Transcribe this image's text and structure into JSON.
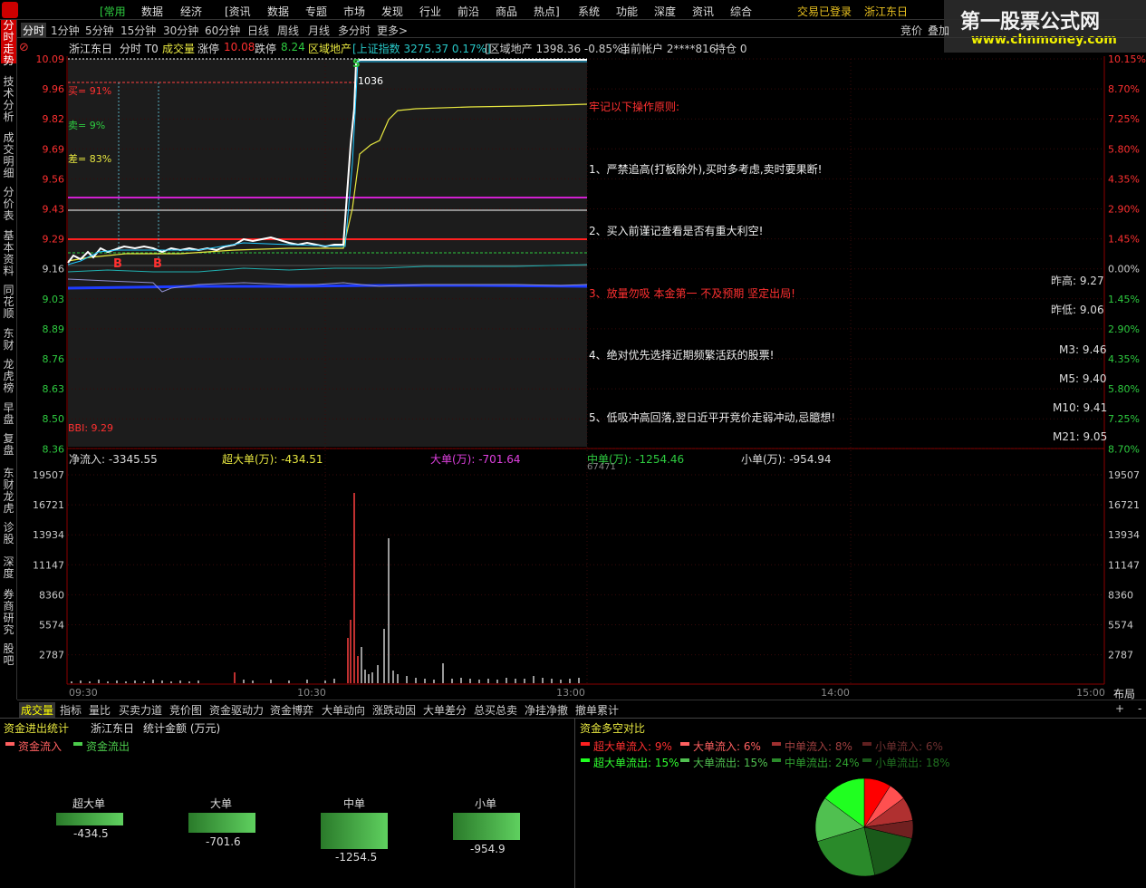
{
  "menu": {
    "items": [
      "[常用",
      "数据",
      "经济",
      "[资讯",
      "数据",
      "专题",
      "市场",
      "发现",
      "行业",
      "前沿",
      "商品",
      "热点]",
      "系统",
      "功能",
      "深度",
      "资讯",
      "综合"
    ],
    "login": "交易已登录",
    "stock": "浙江东日",
    "right_items": [
      "竞价",
      "叠加"
    ]
  },
  "watermark": {
    "title": "第一股票公式网",
    "url": "www.chnmoney.com"
  },
  "sidebar": [
    "分时走势",
    "技术分析",
    "成交明细",
    "分价表",
    "基本资料",
    "同花顺",
    "东财",
    "龙虎榜",
    "早盘",
    "复盘",
    "东财龙虎",
    "诊股",
    "深度",
    "券商研究",
    "股吧"
  ],
  "periods": [
    "分时",
    "1分钟",
    "5分钟",
    "15分钟",
    "30分钟",
    "60分钟",
    "日线",
    "周线",
    "月线",
    "多分时",
    "更多>"
  ],
  "info": {
    "name": "浙江东日",
    "mode": "分时 T0",
    "vol_label": "成交量",
    "zt_label": "涨停",
    "zt": "10.08",
    "dt_label": "跌停",
    "dt": "8.24",
    "sector": "区域地产",
    "index": "[上证指数 3275.37 0.17%]",
    "sector_idx": "[区域地产 1398.36 -0.85%]",
    "account": "当前帐户 2****816",
    "position": "持仓 0"
  },
  "price_axis": [
    "10.09",
    "9.96",
    "9.82",
    "9.69",
    "9.56",
    "9.43",
    "9.29",
    "9.16",
    "9.03",
    "8.89",
    "8.76",
    "8.63",
    "8.50",
    "8.36"
  ],
  "pct_axis": [
    "10.15%",
    "8.70%",
    "7.25%",
    "5.80%",
    "4.35%",
    "2.90%",
    "1.45%",
    "0.00%",
    "1.45%",
    "2.90%",
    "4.35%",
    "5.80%",
    "7.25%",
    "8.70%"
  ],
  "vol_axis": [
    "19507",
    "16721",
    "13934",
    "11147",
    "8360",
    "5574",
    "2787"
  ],
  "time_axis": [
    "09:30",
    "10:30",
    "13:00",
    "14:00",
    "15:00"
  ],
  "overlay": {
    "buy": "买= 91%",
    "sell": "卖= 9%",
    "diff": "差= 83%",
    "bbi": "BBI: 9.29",
    "peak": "1036",
    "b1": "B",
    "b2": "B",
    "s_mark": "S"
  },
  "notes": {
    "title": "牢记以下操作原则:",
    "n1": "1、严禁追高(打板除外),买时多考虑,卖时要果断!",
    "n2": "2、买入前谨记查看是否有重大利空!",
    "n3": "3、放量勿吸 本金第一 不及预期 坚定出局!",
    "n4": "4、绝对优先选择近期频繁活跃的股票!",
    "n5": "5、低吸冲高回落,翌日近平开竞价走弱冲动,忌臆想!"
  },
  "stats": {
    "prev_high": "昨高: 9.27",
    "prev_low": "昨低: 9.06",
    "m3": "M3: 9.46",
    "m5": "M5: 9.40",
    "m10": "M10: 9.41",
    "m21": "M21: 9.05"
  },
  "flow": {
    "net": "净流入: -3345.55",
    "super": "超大单(万): -434.51",
    "large": "大单(万): -701.64",
    "medium": "中单(万): -1254.46",
    "small": "小单(万): -954.94",
    "extra": "67471"
  },
  "layout_btn": "布局",
  "tabs": [
    "成交量",
    "指标",
    "量比",
    "买卖力道",
    "竞价图",
    "资金驱动力",
    "资金博弈",
    "大单动向",
    "涨跌动因",
    "大单差分",
    "总买总卖",
    "净挂净撤",
    "撤单累计"
  ],
  "tab_plus": "+",
  "tab_minus": "-",
  "bottom_left": {
    "title": "资金进出统计",
    "stock": "浙江东日",
    "unit": "统计金额 (万元)",
    "legend_in": "资金流入",
    "legend_out": "资金流出",
    "groups": [
      {
        "label": "超大单",
        "value": "-434.5"
      },
      {
        "label": "大单",
        "value": "-701.6"
      },
      {
        "label": "中单",
        "value": "-1254.5"
      },
      {
        "label": "小单",
        "value": "-954.9"
      }
    ]
  },
  "bottom_right": {
    "title": "资金多空对比",
    "legend": [
      "超大单流入: 9%",
      "大单流入: 6%",
      "中单流入: 8%",
      "小单流入: 6%",
      "超大单流出: 15%",
      "大单流出: 15%",
      "中单流出: 24%",
      "小单流出: 18%"
    ]
  },
  "colors": {
    "red": "#ff2020",
    "green": "#2ecc40",
    "price_line": "#ffffff",
    "avg_line": "#e8e840"
  }
}
